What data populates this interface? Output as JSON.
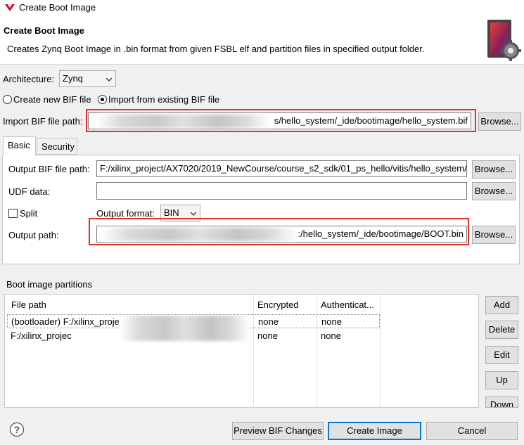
{
  "window": {
    "title": "Create Boot Image"
  },
  "header": {
    "title": "Create Boot Image",
    "description": "Creates Zynq Boot Image in .bin format from given FSBL elf and partition files in specified output folder."
  },
  "architecture": {
    "label": "Architecture:",
    "value": "Zynq"
  },
  "bif_mode": {
    "create_label": "Create new BIF file",
    "import_label": "Import from existing BIF file",
    "selected": "import"
  },
  "import_bif": {
    "label": "Import BIF file path:",
    "value": "s/hello_system/_ide/bootimage/hello_system.bif",
    "browse": "Browse..."
  },
  "tabs": [
    {
      "label": "Basic",
      "active": true
    },
    {
      "label": "Security",
      "active": false
    }
  ],
  "basic": {
    "output_bif_label": "Output BIF file path:",
    "output_bif_value": "F:/xilinx_project/AX7020/2019_NewCourse/course_s2_sdk/01_ps_hello/vitis/hello_system/_i",
    "udf_label": "UDF data:",
    "udf_value": "",
    "split_label": "Split",
    "split_checked": false,
    "output_format_label": "Output format:",
    "output_format_value": "BIN",
    "output_path_label": "Output path:",
    "output_path_value": ":/hello_system/_ide/bootimage/BOOT.bin",
    "browse": "Browse..."
  },
  "partitions": {
    "title": "Boot image partitions",
    "columns": [
      "File path",
      "Encrypted",
      "Authenticat..."
    ],
    "rows": [
      {
        "file": "(bootloader) F:/xilinx_proje",
        "encrypted": "none",
        "auth": "none"
      },
      {
        "file": "F:/xilinx_projec",
        "encrypted": "none",
        "auth": "none"
      }
    ],
    "buttons": {
      "add": "Add",
      "delete": "Delete",
      "edit": "Edit",
      "up": "Up",
      "down": "Down"
    }
  },
  "footer": {
    "preview": "Preview BIF Changes",
    "create": "Create Image",
    "cancel": "Cancel"
  },
  "icons": [
    "xilinx-logo-icon",
    "boot-image-gear-icon",
    "help-icon",
    "chevron-down-icon"
  ],
  "colors": {
    "highlight_box": "#e03131",
    "default_button_border": "#0078d7"
  }
}
